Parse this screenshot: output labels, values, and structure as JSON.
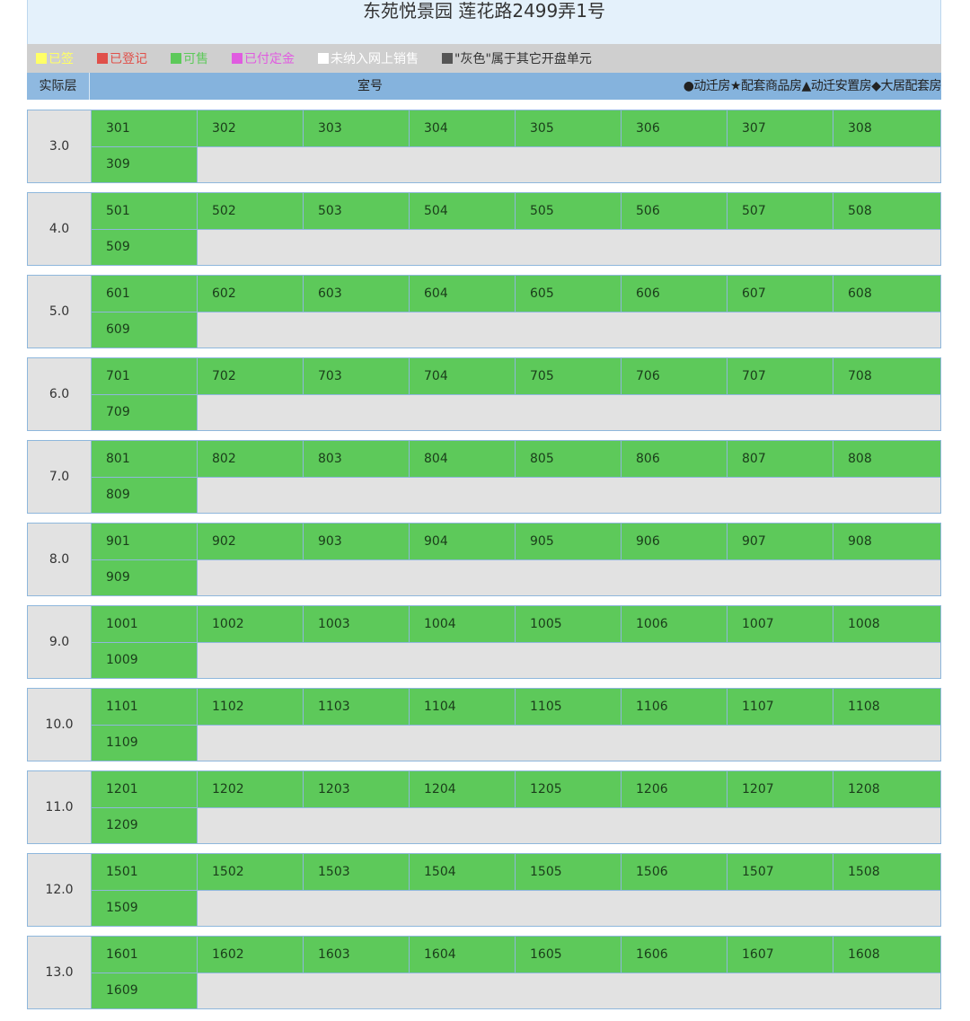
{
  "title": "东苑悦景园 莲花路2499弄1号",
  "legend": [
    {
      "label": "已签",
      "color": "#ffff66",
      "text_color": "#ffff66"
    },
    {
      "label": "已登记",
      "color": "#e0504a",
      "text_color": "#e0504a"
    },
    {
      "label": "可售",
      "color": "#5dc95a",
      "text_color": "#5dc95a"
    },
    {
      "label": "已付定金",
      "color": "#e05ce0",
      "text_color": "#e05ce0"
    },
    {
      "label": "未纳入网上销售",
      "color": "#ffffff",
      "text_color": "#ffffff"
    },
    {
      "label": "\"灰色\"属于其它开盘单元",
      "color": "#555555",
      "text_color": "#333333"
    }
  ],
  "header": {
    "floor_col": "实际层",
    "room_col": "室号",
    "marks": "●动迁房★配套商品房▲动迁安置房◆大居配套房"
  },
  "floors": [
    {
      "floor": "3.0",
      "rooms": [
        "301",
        "302",
        "303",
        "304",
        "305",
        "306",
        "307",
        "308"
      ],
      "extra": "309"
    },
    {
      "floor": "4.0",
      "rooms": [
        "501",
        "502",
        "503",
        "504",
        "505",
        "506",
        "507",
        "508"
      ],
      "extra": "509"
    },
    {
      "floor": "5.0",
      "rooms": [
        "601",
        "602",
        "603",
        "604",
        "605",
        "606",
        "607",
        "608"
      ],
      "extra": "609"
    },
    {
      "floor": "6.0",
      "rooms": [
        "701",
        "702",
        "703",
        "704",
        "705",
        "706",
        "707",
        "708"
      ],
      "extra": "709"
    },
    {
      "floor": "7.0",
      "rooms": [
        "801",
        "802",
        "803",
        "804",
        "805",
        "806",
        "807",
        "808"
      ],
      "extra": "809"
    },
    {
      "floor": "8.0",
      "rooms": [
        "901",
        "902",
        "903",
        "904",
        "905",
        "906",
        "907",
        "908"
      ],
      "extra": "909"
    },
    {
      "floor": "9.0",
      "rooms": [
        "1001",
        "1002",
        "1003",
        "1004",
        "1005",
        "1006",
        "1007",
        "1008"
      ],
      "extra": "1009"
    },
    {
      "floor": "10.0",
      "rooms": [
        "1101",
        "1102",
        "1103",
        "1104",
        "1105",
        "1106",
        "1107",
        "1108"
      ],
      "extra": "1109"
    },
    {
      "floor": "11.0",
      "rooms": [
        "1201",
        "1202",
        "1203",
        "1204",
        "1205",
        "1206",
        "1207",
        "1208"
      ],
      "extra": "1209"
    },
    {
      "floor": "12.0",
      "rooms": [
        "1501",
        "1502",
        "1503",
        "1504",
        "1505",
        "1506",
        "1507",
        "1508"
      ],
      "extra": "1509"
    },
    {
      "floor": "13.0",
      "rooms": [
        "1601",
        "1602",
        "1603",
        "1604",
        "1605",
        "1606",
        "1607",
        "1608"
      ],
      "extra": "1609"
    }
  ]
}
